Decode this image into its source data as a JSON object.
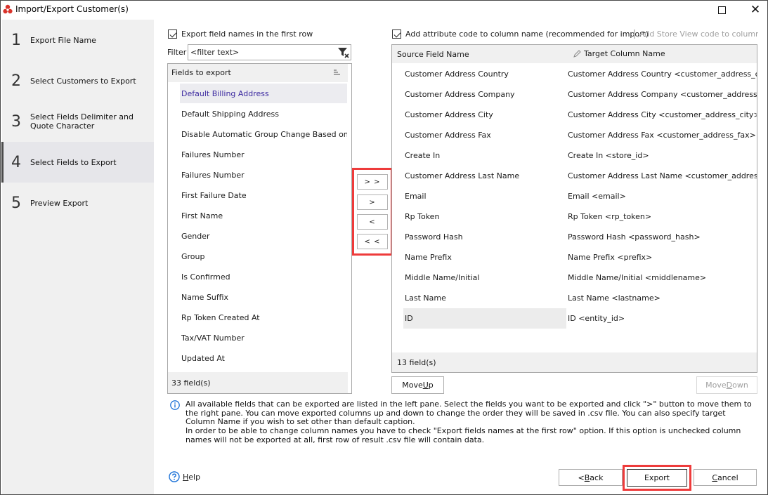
{
  "window": {
    "title": "Import/Export Customer(s)",
    "maximize_icon": "maximize-icon",
    "close_icon": "close-icon"
  },
  "sidebar": {
    "steps": [
      {
        "number": "1",
        "label": "Export File Name",
        "active": false
      },
      {
        "number": "2",
        "label": "Select Customers to Export",
        "active": false
      },
      {
        "number": "3",
        "label": "Select Fields Delimiter and Quote Character",
        "active": false
      },
      {
        "number": "4",
        "label": "Select Fields to Export",
        "active": true
      },
      {
        "number": "5",
        "label": "Preview Export",
        "active": false
      }
    ]
  },
  "left_pane": {
    "export_names_checkbox": {
      "label": "Export field names in the  first row",
      "checked": true
    },
    "filter_label": "Filter",
    "filter_placeholder": "<filter text>",
    "list_header": "Fields to export",
    "items": [
      "Default Billing Address",
      "Default Shipping Address",
      "Disable Automatic Group Change Based on VAT ID",
      "Failures Number",
      "Failures Number",
      "First Failure Date",
      "First Name",
      "Gender",
      "Group",
      "Is Confirmed",
      "Name Suffix",
      "Rp Token Created At",
      "Tax/VAT Number",
      "Updated At"
    ],
    "selected_index": 0,
    "count": "33 field(s)"
  },
  "move_buttons": {
    "add_all": "> >",
    "add": ">",
    "remove": "<",
    "remove_all": "< <"
  },
  "right_pane": {
    "attr_code_checkbox": {
      "label": "Add attribute code to column name (recommended for import)",
      "checked": true
    },
    "store_view_checkbox": {
      "label": "Add Store View code to column name",
      "checked": true,
      "disabled": true
    },
    "columns": {
      "source": "Source Field Name",
      "target": "Target Column Name"
    },
    "rows": [
      {
        "source": "Customer Address Country",
        "target": "Customer Address Country <customer_address_country>"
      },
      {
        "source": "Customer Address Company",
        "target": "Customer Address Company <customer_address_company>"
      },
      {
        "source": "Customer Address City",
        "target": "Customer Address City <customer_address_city>"
      },
      {
        "source": "Customer Address Fax",
        "target": "Customer Address Fax <customer_address_fax>"
      },
      {
        "source": "Create In",
        "target": "Create In <store_id>"
      },
      {
        "source": "Customer Address Last Name",
        "target": "Customer Address Last Name <customer_address_lastname>"
      },
      {
        "source": "Email",
        "target": "Email <email>"
      },
      {
        "source": "Rp Token",
        "target": "Rp Token <rp_token>"
      },
      {
        "source": "Password Hash",
        "target": "Password Hash <password_hash>"
      },
      {
        "source": "Name Prefix",
        "target": "Name Prefix <prefix>"
      },
      {
        "source": "Middle Name/Initial",
        "target": "Middle Name/Initial <middlename>"
      },
      {
        "source": "Last Name",
        "target": "Last Name <lastname>"
      },
      {
        "source": "ID",
        "target": "ID <entity_id>"
      }
    ],
    "selected_index": 12,
    "count": "13 field(s)",
    "move_up": {
      "pre": "Move ",
      "key": "U",
      "post": "p"
    },
    "move_down": {
      "pre": "Move ",
      "key": "D",
      "post": "own"
    }
  },
  "info": {
    "paragraph1": "All available fields that can be exported are listed in the left pane. Select the fields you want to be exported and click \">\" button to move them to the right pane. You can move exported columns up and down to change the order they will be saved in .csv file. You can also specify target Column Name if you wish to set other than default caption.",
    "paragraph2": "In order to be able to change column names you have to check \"Export fields names at the first row\" option. If this option is unchecked column names will not be exported at all, first row of result .csv file will contain data."
  },
  "footer": {
    "help": {
      "key": "H",
      "rest": "elp"
    },
    "back": {
      "pre": "< ",
      "key": "B",
      "post": "ack"
    },
    "export": "Export",
    "cancel": {
      "key": "C",
      "post": "ancel"
    }
  },
  "colors": {
    "highlight": "#ee3b3b",
    "selected_text": "#3c2aa0",
    "sidebar_bg": "#f0f0f0",
    "info_blue": "#1e73d8"
  }
}
